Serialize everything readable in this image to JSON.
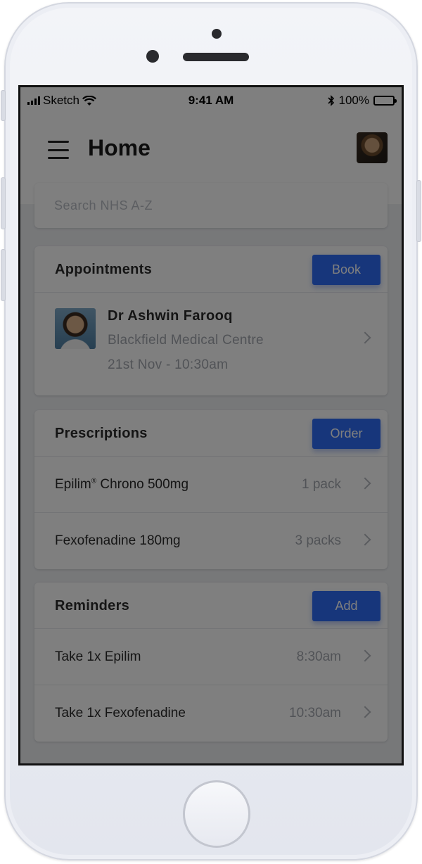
{
  "status_bar": {
    "carrier": "Sketch",
    "time": "9:41 AM",
    "battery": "100%"
  },
  "header": {
    "title": "Home"
  },
  "search": {
    "placeholder": "Search NHS A-Z"
  },
  "appointments": {
    "title": "Appointments",
    "button": "Book",
    "item": {
      "doctor": "Dr Ashwin Farooq",
      "location": "Blackfield Medical Centre",
      "datetime": "21st Nov - 10:30am"
    }
  },
  "prescriptions": {
    "title": "Prescriptions",
    "button": "Order",
    "items": [
      {
        "name": "Epilim",
        "reg": "®",
        "name_rest": " Chrono 500mg",
        "qty": "1 pack"
      },
      {
        "name": "Fexofenadine 180mg",
        "qty": "3 packs"
      }
    ]
  },
  "reminders": {
    "title": "Reminders",
    "button": "Add",
    "items": [
      {
        "label": "Take 1x Epilim",
        "time": "8:30am"
      },
      {
        "label": "Take 1x Fexofenadine",
        "time": "10:30am"
      }
    ]
  },
  "colors": {
    "accent": "#2f6df6",
    "overlay": "rgba(0,0,0,0.5)"
  },
  "icons": [
    "menu-icon",
    "wifi-icon",
    "bluetooth-icon",
    "battery-icon",
    "chevron-right-icon"
  ]
}
